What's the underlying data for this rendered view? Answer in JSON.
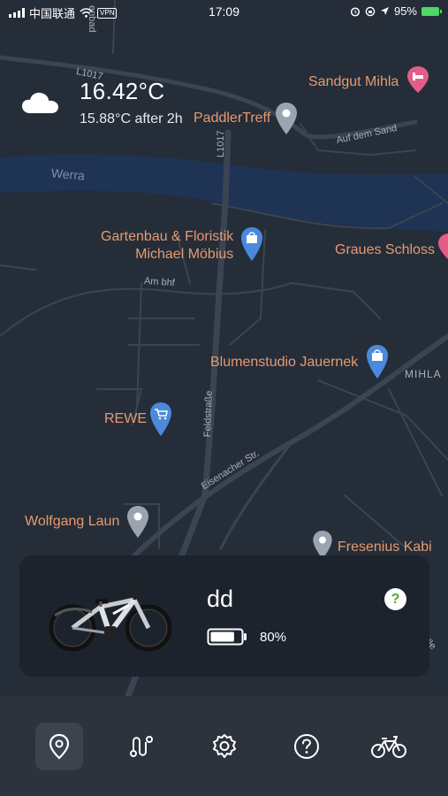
{
  "status_bar": {
    "carrier": "中国联通",
    "vpn": "VPN",
    "time": "17:09",
    "battery": "95%"
  },
  "weather": {
    "icon": "cloud-icon",
    "temperature": "16.42°C",
    "forecast": "15.88°C after 2h"
  },
  "map": {
    "pois": [
      {
        "label": "Sandgut Mihla",
        "icon": "bed-pin-icon"
      },
      {
        "label": "PaddlerTreff",
        "icon": "gray-pin-icon"
      },
      {
        "label": "Gartenbau & Floristik\nMichael Möbius",
        "icon": "shopping-bag-pin-icon"
      },
      {
        "label": "Graues Schloss",
        "icon": "bed-pin-icon"
      },
      {
        "label": "Blumenstudio Jauernek",
        "icon": "shopping-bag-pin-icon"
      },
      {
        "label": "REWE",
        "icon": "shopping-cart-pin-icon"
      },
      {
        "label": "Wolfgang Laun",
        "icon": "gray-pin-icon"
      },
      {
        "label": "Fresenius Kabi",
        "icon": "gray-pin-icon"
      }
    ],
    "streets": {
      "top_road": "enbad",
      "l1017_a": "L1017",
      "l1017_b": "L1017",
      "auf_dem_sand": "Auf dem Sand",
      "am_bhf": "Am bhf",
      "feldstrasse": "Feldstraße",
      "eisenacher": "Eisenacher Str.",
      "delle": "Delle",
      "town": "MIHLA",
      "river": "Werra"
    },
    "colors": {
      "background": "#252d39",
      "water": "#1f3355",
      "road": "#3a4452",
      "poi_text": "#e79a6e",
      "pin_blue": "#4a89dc",
      "pin_pink": "#e35d86",
      "pin_gray": "#9aa4b1"
    }
  },
  "bike_card": {
    "name": "dd",
    "battery_percent": "80%",
    "battery_level": 0.8,
    "help_label": "?"
  },
  "tabbar": {
    "tabs": [
      {
        "name": "map",
        "icon": "location-pin-icon",
        "active": true
      },
      {
        "name": "routes",
        "icon": "route-icon",
        "active": false
      },
      {
        "name": "settings",
        "icon": "gear-icon",
        "active": false
      },
      {
        "name": "help",
        "icon": "question-circle-icon",
        "active": false
      },
      {
        "name": "bike",
        "icon": "bicycle-icon",
        "active": false
      }
    ]
  }
}
